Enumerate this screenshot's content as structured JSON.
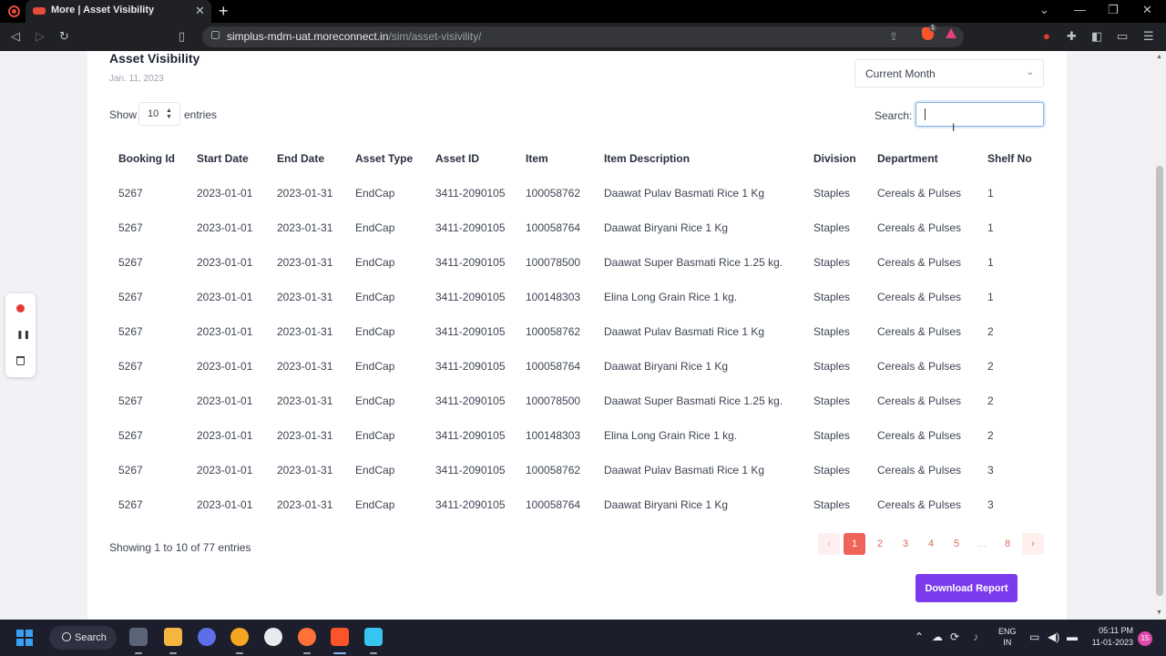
{
  "browser": {
    "tab_title": "More | Asset Visibility",
    "url_host": "simplus-mdm-uat.moreconnect.in",
    "url_path": "/sim/asset-visivility/",
    "brave_badge": "1"
  },
  "page": {
    "title": "Asset Visibility",
    "date": "Jan. 11, 2023",
    "period_selected": "Current Month",
    "show_label": "Show",
    "page_length": "10",
    "entries_label": "entries",
    "search_label": "Search:",
    "search_value": ""
  },
  "table": {
    "columns": [
      "Booking Id",
      "Start Date",
      "End Date",
      "Asset Type",
      "Asset ID",
      "Item",
      "Item Description",
      "Division",
      "Department",
      "Shelf No"
    ],
    "rows": [
      [
        "5267",
        "2023-01-01",
        "2023-01-31",
        "EndCap",
        "3411-2090105",
        "100058762",
        "Daawat Pulav Basmati Rice 1 Kg",
        "Staples",
        "Cereals & Pulses",
        "1"
      ],
      [
        "5267",
        "2023-01-01",
        "2023-01-31",
        "EndCap",
        "3411-2090105",
        "100058764",
        "Daawat Biryani Rice 1 Kg",
        "Staples",
        "Cereals & Pulses",
        "1"
      ],
      [
        "5267",
        "2023-01-01",
        "2023-01-31",
        "EndCap",
        "3411-2090105",
        "100078500",
        "Daawat Super Basmati Rice 1.25 kg.",
        "Staples",
        "Cereals & Pulses",
        "1"
      ],
      [
        "5267",
        "2023-01-01",
        "2023-01-31",
        "EndCap",
        "3411-2090105",
        "100148303",
        "Elina Long Grain Rice 1 kg.",
        "Staples",
        "Cereals & Pulses",
        "1"
      ],
      [
        "5267",
        "2023-01-01",
        "2023-01-31",
        "EndCap",
        "3411-2090105",
        "100058762",
        "Daawat Pulav Basmati Rice 1 Kg",
        "Staples",
        "Cereals & Pulses",
        "2"
      ],
      [
        "5267",
        "2023-01-01",
        "2023-01-31",
        "EndCap",
        "3411-2090105",
        "100058764",
        "Daawat Biryani Rice 1 Kg",
        "Staples",
        "Cereals & Pulses",
        "2"
      ],
      [
        "5267",
        "2023-01-01",
        "2023-01-31",
        "EndCap",
        "3411-2090105",
        "100078500",
        "Daawat Super Basmati Rice 1.25 kg.",
        "Staples",
        "Cereals & Pulses",
        "2"
      ],
      [
        "5267",
        "2023-01-01",
        "2023-01-31",
        "EndCap",
        "3411-2090105",
        "100148303",
        "Elina Long Grain Rice 1 kg.",
        "Staples",
        "Cereals & Pulses",
        "2"
      ],
      [
        "5267",
        "2023-01-01",
        "2023-01-31",
        "EndCap",
        "3411-2090105",
        "100058762",
        "Daawat Pulav Basmati Rice 1 Kg",
        "Staples",
        "Cereals & Pulses",
        "3"
      ],
      [
        "5267",
        "2023-01-01",
        "2023-01-31",
        "EndCap",
        "3411-2090105",
        "100058764",
        "Daawat Biryani Rice 1 Kg",
        "Staples",
        "Cereals & Pulses",
        "3"
      ]
    ]
  },
  "footer": {
    "info": "Showing 1 to 10 of 77 entries",
    "pages": [
      "1",
      "2",
      "3",
      "4",
      "5",
      "…",
      "8"
    ],
    "current_page": "1",
    "download_label": "Download Report"
  },
  "taskbar": {
    "search_label": "Search",
    "lang_line1": "ENG",
    "lang_line2": "IN",
    "time": "05:11 PM",
    "date": "11-01-2023",
    "notification_count": "15"
  },
  "colors": {
    "accent_purple": "#7c3aed",
    "pager_active": "#f0635b",
    "record_red": "#e53935"
  }
}
